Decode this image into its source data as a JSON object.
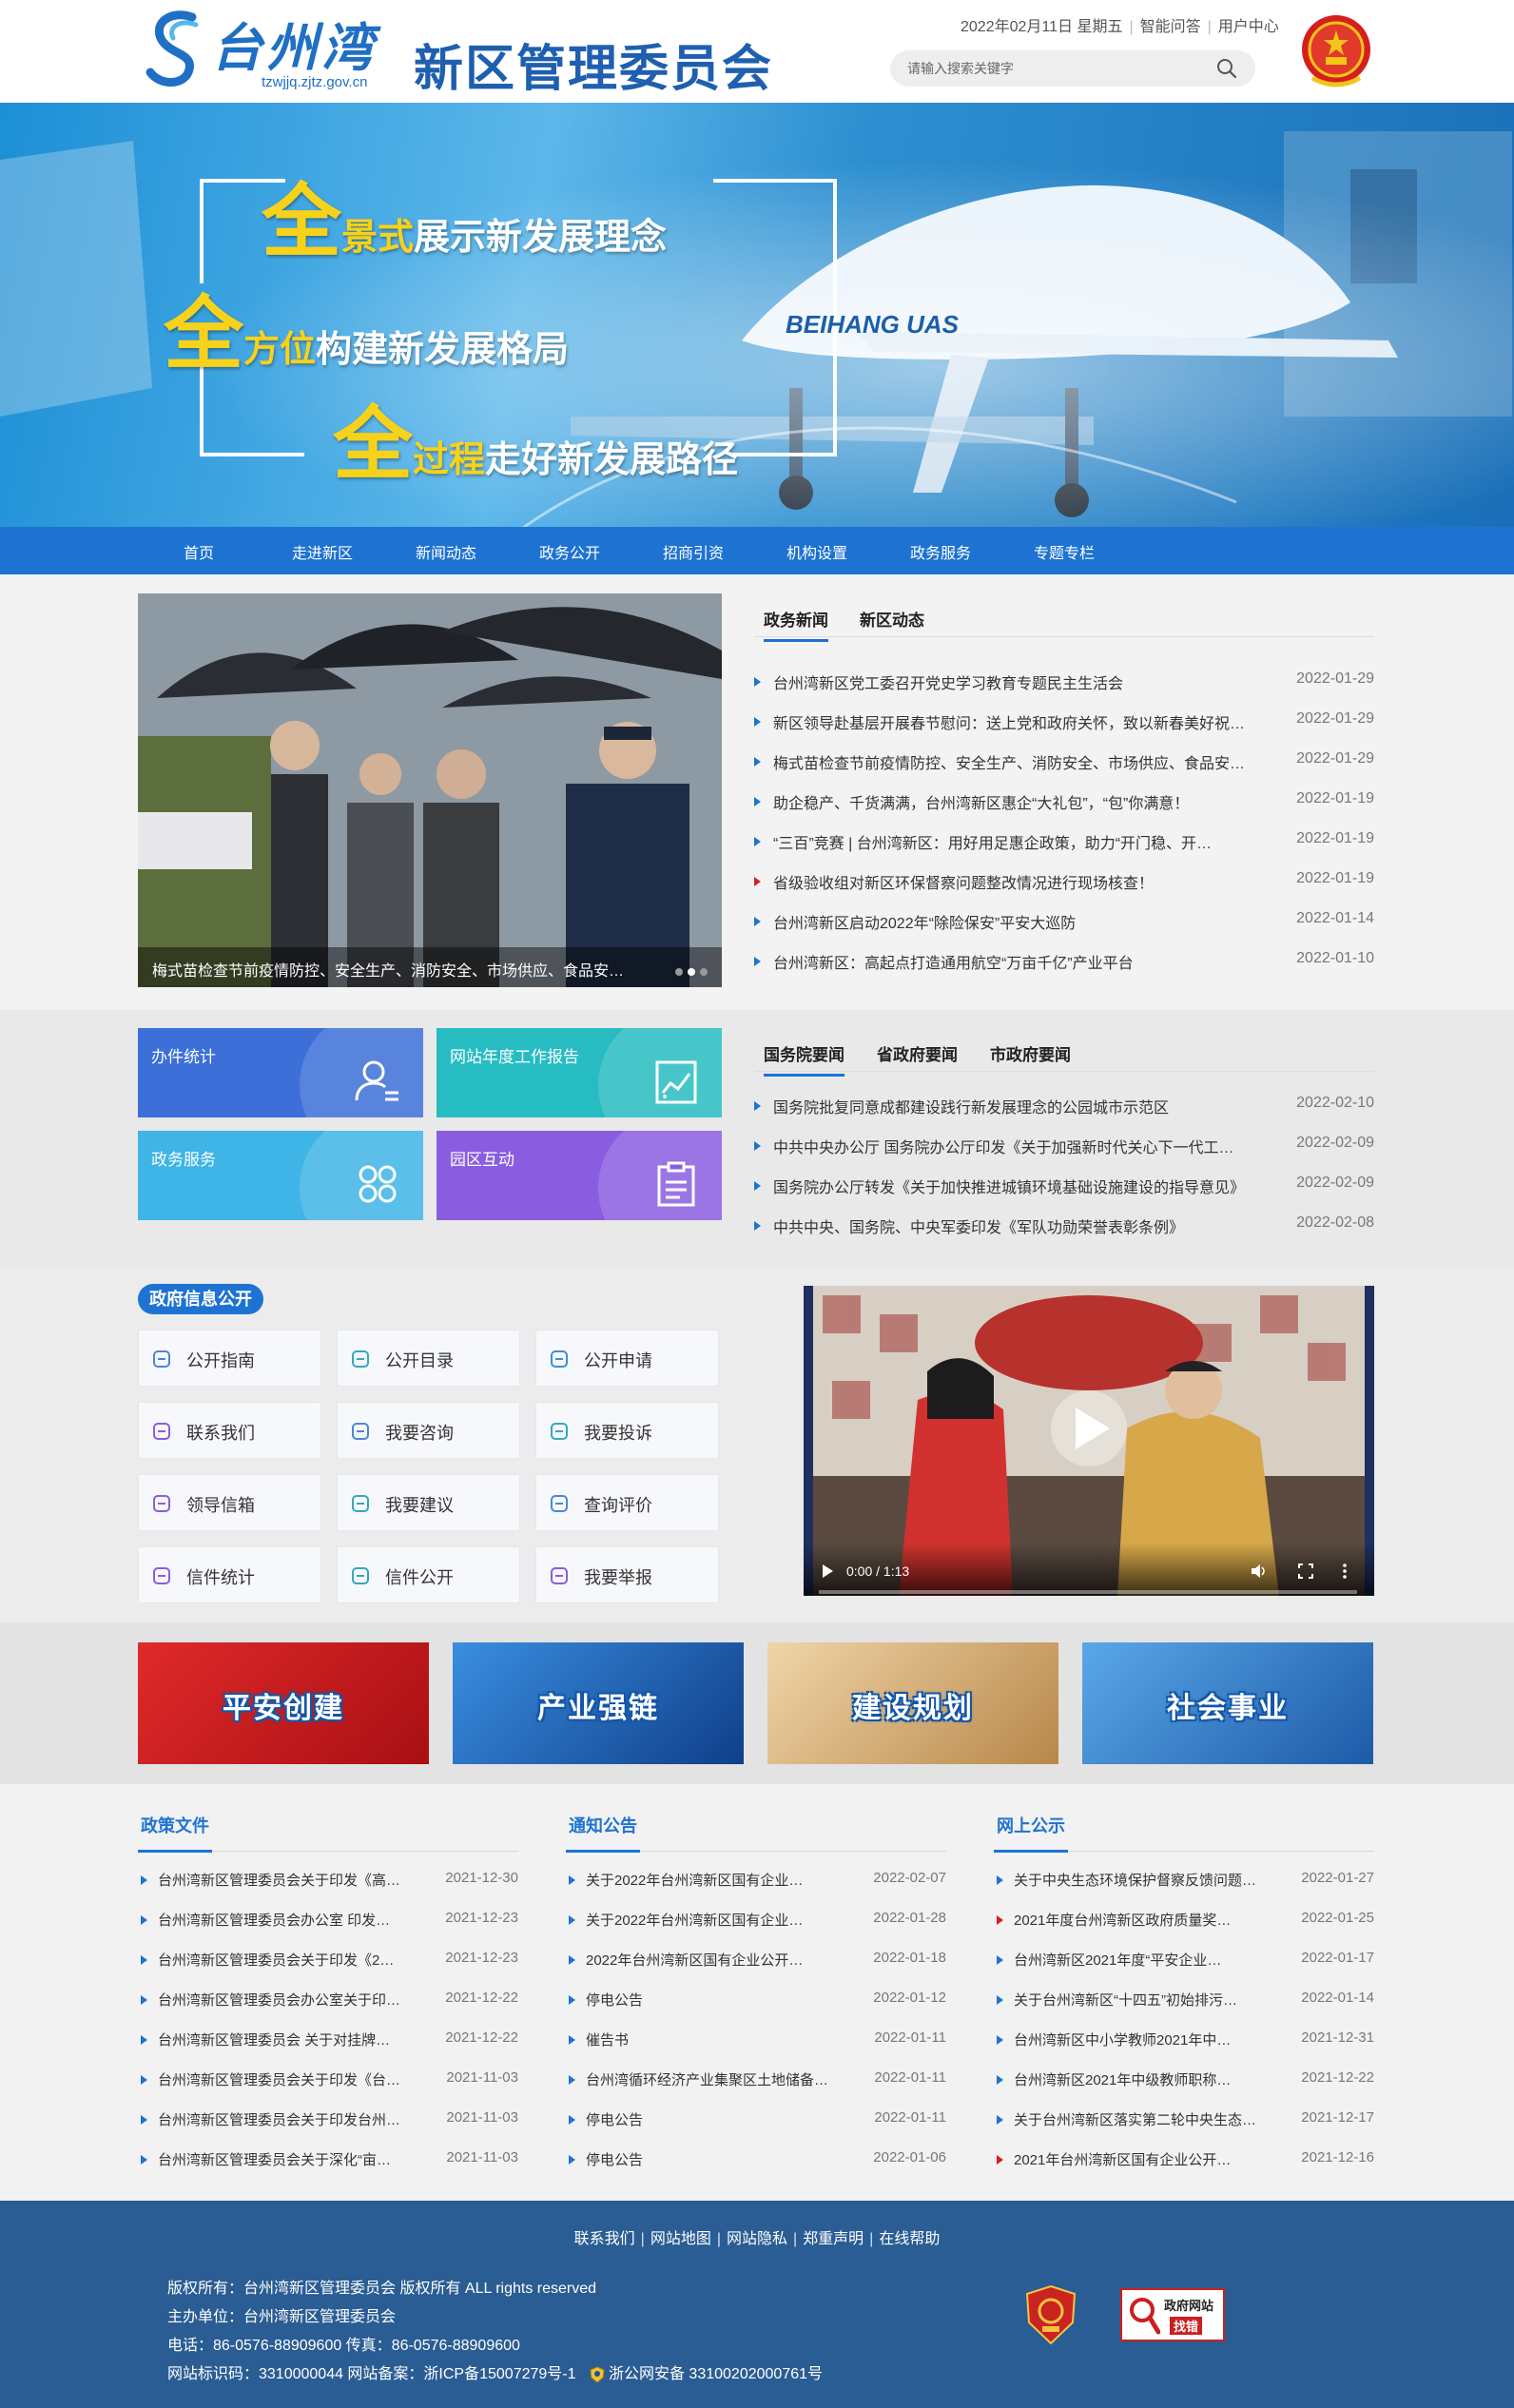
{
  "header": {
    "logo_text": "台州湾",
    "logo_url": "tzwjjq.zjtz.gov.cn",
    "site_title": "新区管理委员会",
    "date": "2022年02月11日 星期五",
    "links": [
      "智能问答",
      "用户中心"
    ],
    "search_placeholder": "请输入搜索关键字"
  },
  "banner": {
    "lines": [
      {
        "big": "全",
        "mid": "景式",
        "rest": "展示新发展理念"
      },
      {
        "big": "全",
        "mid": "方位",
        "rest": "构建新发展格局"
      },
      {
        "big": "全",
        "mid": "过程",
        "rest": "走好新发展路径"
      }
    ],
    "brandmark": "BEIHANG UAS"
  },
  "nav": [
    "首页",
    "走进新区",
    "新闻动态",
    "政务公开",
    "招商引资",
    "机构设置",
    "政务服务",
    "专题专栏"
  ],
  "featured": {
    "caption": "梅式苗检查节前疫情防控、安全生产、消防安全、市场供应、食品安…"
  },
  "news_tabs": [
    "政务新闻",
    "新区动态"
  ],
  "news": [
    {
      "title": "台州湾新区党工委召开党史学习教育专题民主生活会",
      "date": "2022-01-29",
      "red": false
    },
    {
      "title": "新区领导赴基层开展春节慰问：送上党和政府关怀，致以新春美好祝…",
      "date": "2022-01-29",
      "red": false
    },
    {
      "title": "梅式苗检查节前疫情防控、安全生产、消防安全、市场供应、食品安…",
      "date": "2022-01-29",
      "red": false
    },
    {
      "title": "助企稳产、千货满满，台州湾新区惠企“大礼包”，“包”你满意！",
      "date": "2022-01-19",
      "red": false
    },
    {
      "title": "“三百”竞赛 | 台州湾新区：用好用足惠企政策，助力“开门稳、开…",
      "date": "2022-01-19",
      "red": false
    },
    {
      "title": "省级验收组对新区环保督察问题整改情况进行现场核查！",
      "date": "2022-01-19",
      "red": true
    },
    {
      "title": "台州湾新区启动2022年“除险保安”平安大巡防",
      "date": "2022-01-14",
      "red": false
    },
    {
      "title": "台州湾新区：高起点打造通用航空“万亩千亿”产业平台",
      "date": "2022-01-10",
      "red": false
    }
  ],
  "tiles": [
    {
      "label": "办件统计",
      "color": "#3c6fd8",
      "icon": "user-list-icon"
    },
    {
      "label": "网站年度工作报告",
      "color": "#27bcc1",
      "icon": "report-chart-icon"
    },
    {
      "label": "政务服务",
      "color": "#3fb4e6",
      "icon": "grid-flower-icon"
    },
    {
      "label": "园区互动",
      "color": "#8a5de0",
      "icon": "clipboard-icon"
    }
  ],
  "gov_tabs": [
    "国务院要闻",
    "省政府要闻",
    "市政府要闻"
  ],
  "gov_news": [
    {
      "title": "国务院批复同意成都建设践行新发展理念的公园城市示范区",
      "date": "2022-02-10"
    },
    {
      "title": "中共中央办公厅 国务院办公厅印发《关于加强新时代关心下一代工…",
      "date": "2022-02-09"
    },
    {
      "title": "国务院办公厅转发《关于加快推进城镇环境基础设施建设的指导意见》",
      "date": "2022-02-09"
    },
    {
      "title": "中共中央、国务院、中央军委印发《军队功勋荣誉表彰条例》",
      "date": "2022-02-08"
    }
  ],
  "info_open": {
    "title": "政府信息公开",
    "buttons": [
      {
        "label": "公开指南",
        "icon": "compass-icon"
      },
      {
        "label": "公开目录",
        "icon": "list-icon"
      },
      {
        "label": "公开申请",
        "icon": "apply-icon"
      },
      {
        "label": "联系我们",
        "icon": "phone-icon"
      },
      {
        "label": "我要咨询",
        "icon": "chat-icon"
      },
      {
        "label": "我要投诉",
        "icon": "pen-icon"
      },
      {
        "label": "领导信箱",
        "icon": "phone-box-icon"
      },
      {
        "label": "我要建议",
        "icon": "suggest-icon"
      },
      {
        "label": "查询评价",
        "icon": "evaluate-icon"
      },
      {
        "label": "信件统计",
        "icon": "bar-chart-icon"
      },
      {
        "label": "信件公开",
        "icon": "letter-icon"
      },
      {
        "label": "我要举报",
        "icon": "report-pen-icon"
      }
    ]
  },
  "video": {
    "time": "0:00 / 1:13"
  },
  "banners": [
    {
      "label": "平安创建",
      "color": "#c8191f"
    },
    {
      "label": "产业强链",
      "color": "#1e5fb4"
    },
    {
      "label": "建设规划",
      "color": "#c79a5e"
    },
    {
      "label": "社会事业",
      "color": "#2a74c0"
    }
  ],
  "columns": [
    {
      "title": "政策文件",
      "items": [
        {
          "title": "台州湾新区管理委员会关于印发《高…",
          "date": "2021-12-30",
          "red": false
        },
        {
          "title": "台州湾新区管理委员会办公室 印发…",
          "date": "2021-12-23",
          "red": false
        },
        {
          "title": "台州湾新区管理委员会关于印发《2…",
          "date": "2021-12-23",
          "red": false
        },
        {
          "title": "台州湾新区管理委员会办公室关于印…",
          "date": "2021-12-22",
          "red": false
        },
        {
          "title": "台州湾新区管理委员会 关于对挂牌…",
          "date": "2021-12-22",
          "red": false
        },
        {
          "title": "台州湾新区管理委员会关于印发《台…",
          "date": "2021-11-03",
          "red": false
        },
        {
          "title": "台州湾新区管理委员会关于印发台州…",
          "date": "2021-11-03",
          "red": false
        },
        {
          "title": "台州湾新区管理委员会关于深化“亩…",
          "date": "2021-11-03",
          "red": false
        }
      ]
    },
    {
      "title": "通知公告",
      "items": [
        {
          "title": "关于2022年台州湾新区国有企业…",
          "date": "2022-02-07",
          "red": false
        },
        {
          "title": "关于2022年台州湾新区国有企业…",
          "date": "2022-01-28",
          "red": false
        },
        {
          "title": "2022年台州湾新区国有企业公开…",
          "date": "2022-01-18",
          "red": false
        },
        {
          "title": "停电公告",
          "date": "2022-01-12",
          "red": false
        },
        {
          "title": "催告书",
          "date": "2022-01-11",
          "red": false
        },
        {
          "title": "台州湾循环经济产业集聚区土地储备…",
          "date": "2022-01-11",
          "red": false
        },
        {
          "title": "停电公告",
          "date": "2022-01-11",
          "red": false
        },
        {
          "title": "停电公告",
          "date": "2022-01-06",
          "red": false
        }
      ]
    },
    {
      "title": "网上公示",
      "items": [
        {
          "title": "关于中央生态环境保护督察反馈问题…",
          "date": "2022-01-27",
          "red": false
        },
        {
          "title": "2021年度台州湾新区政府质量奖…",
          "date": "2022-01-25",
          "red": true
        },
        {
          "title": "台州湾新区2021年度“平安企业…",
          "date": "2022-01-17",
          "red": false
        },
        {
          "title": "关于台州湾新区“十四五”初始排污…",
          "date": "2022-01-14",
          "red": false
        },
        {
          "title": "台州湾新区中小学教师2021年中…",
          "date": "2021-12-31",
          "red": false
        },
        {
          "title": "台州湾新区2021年中级教师职称…",
          "date": "2021-12-22",
          "red": false
        },
        {
          "title": "关于台州湾新区落实第二轮中央生态…",
          "date": "2021-12-17",
          "red": false
        },
        {
          "title": "2021年台州湾新区国有企业公开…",
          "date": "2021-12-16",
          "red": true
        }
      ]
    }
  ],
  "footer": {
    "links": [
      "联系我们",
      "网站地图",
      "网站隐私",
      "郑重声明",
      "在线帮助"
    ],
    "copyright": "版权所有：台州湾新区管理委员会 版权所有 ALL rights reserved",
    "sponsor": "主办单位：台州湾新区管理委员会",
    "phone": "电话：86-0576-88909600  传真：86-0576-88909600",
    "ids": "网站标识码：3310000044  网站备案：浙ICP备15007279号-1",
    "police": "浙公网安备 33100202000761号",
    "badge_top": "政府网站",
    "badge_bottom": "找错"
  }
}
